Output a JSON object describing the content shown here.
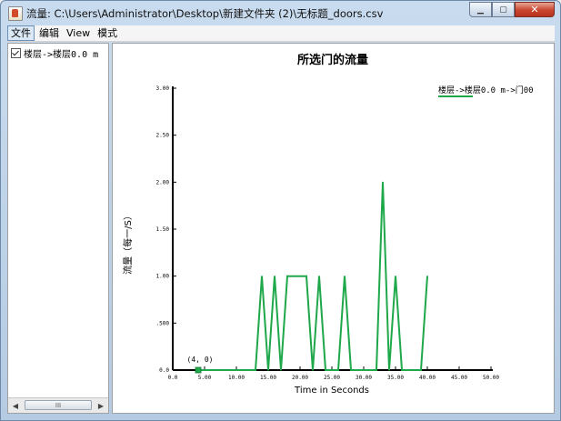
{
  "window": {
    "title": "流量: C:\\Users\\Administrator\\Desktop\\新建文件夹 (2)\\无标题_doors.csv",
    "minimize_glyph": "▁",
    "maximize_glyph": "▢",
    "close_glyph": "✕"
  },
  "menu": [
    {
      "label": "文件",
      "active": true
    },
    {
      "label": "编辑",
      "active": false
    },
    {
      "label": "View",
      "active": false
    },
    {
      "label": "模式",
      "active": false
    }
  ],
  "tree": {
    "items": [
      {
        "label": "楼层->楼层0.0 m",
        "checked": true
      }
    ],
    "scroll_glyph": "III"
  },
  "colors": {
    "series": "#1ea84a",
    "axis": "#000000",
    "marker": "#1ea84a"
  },
  "chart_data": {
    "type": "line",
    "title": "所选门的流量",
    "xlabel": "Time in Seconds",
    "ylabel": "流量（每一/S）",
    "xlim": [
      0,
      50
    ],
    "ylim": [
      0,
      3
    ],
    "x_ticks": [
      "0.0",
      "5.00",
      "10.00",
      "15.00",
      "20.00",
      "25.00",
      "30.00",
      "35.00",
      "40.00",
      "45.00",
      "50.00"
    ],
    "y_ticks": [
      "0.0",
      ".500",
      "1.00",
      "1.50",
      "2.00",
      "2.50",
      "3.00"
    ],
    "legend_position": "top-right",
    "annotation": {
      "text": "(4, 0)",
      "x": 4,
      "y": 0
    },
    "series": [
      {
        "name": "楼层->楼层0.0 m->门00",
        "x": [
          4,
          5,
          13,
          14,
          15,
          16,
          17,
          18,
          19,
          21,
          22,
          23,
          24,
          26,
          27,
          28,
          32,
          33,
          34,
          35,
          36,
          39,
          40
        ],
        "y": [
          0,
          0,
          0,
          1,
          0,
          1,
          0,
          1,
          1,
          1,
          0,
          1,
          0,
          0,
          1,
          0,
          0,
          2,
          0,
          1,
          0,
          0,
          1
        ]
      }
    ]
  }
}
